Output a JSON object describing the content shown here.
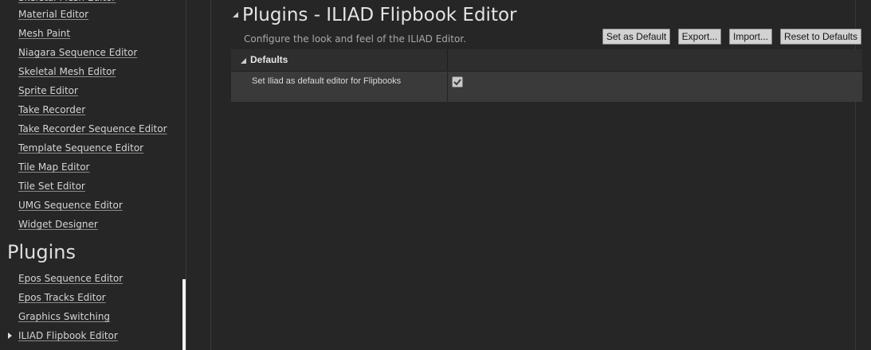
{
  "sidebar": {
    "editor_items": [
      {
        "label": "Material Editor"
      },
      {
        "label": "Mesh Paint"
      },
      {
        "label": "Niagara Sequence Editor"
      },
      {
        "label": "Skeletal Mesh Editor"
      },
      {
        "label": "Sprite Editor"
      },
      {
        "label": "Take Recorder"
      },
      {
        "label": "Take Recorder Sequence Editor"
      },
      {
        "label": "Template Sequence Editor"
      },
      {
        "label": "Tile Map Editor"
      },
      {
        "label": "Tile Set Editor"
      },
      {
        "label": "UMG Sequence Editor"
      },
      {
        "label": "Widget Designer"
      }
    ],
    "section_title": "Plugins",
    "plugin_items": [
      {
        "label": "Epos Sequence Editor"
      },
      {
        "label": "Epos Tracks Editor"
      },
      {
        "label": "Graphics Switching"
      },
      {
        "label": "ILIAD Flipbook Editor"
      }
    ]
  },
  "main": {
    "title": "Plugins - ILIAD Flipbook Editor",
    "subtitle": "Configure the look and feel of the ILIAD Editor.",
    "buttons": {
      "set_default": "Set as Default",
      "export": "Export...",
      "import": "Import...",
      "reset": "Reset to Defaults"
    },
    "category": "Defaults",
    "settings": [
      {
        "label": "Set Iliad as default editor for Flipbooks",
        "checked": true
      }
    ]
  }
}
